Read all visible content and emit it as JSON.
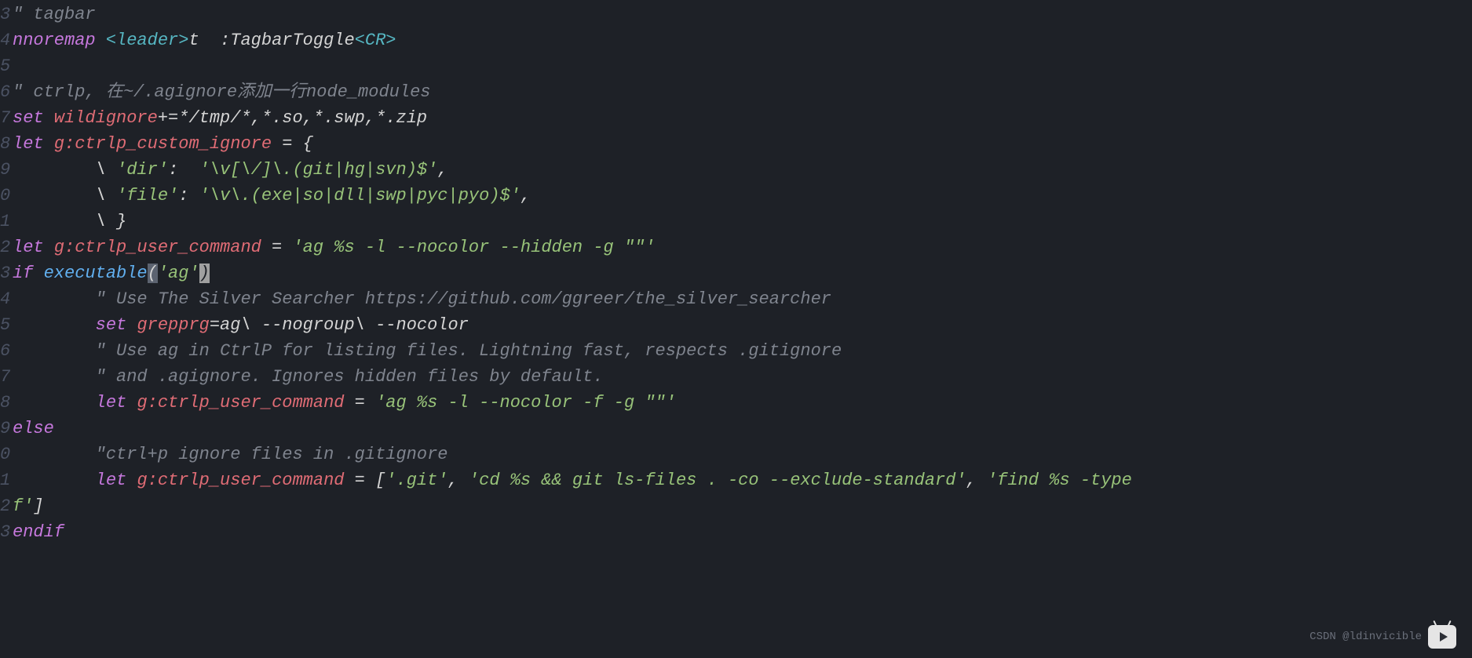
{
  "gutter": {
    "l1": "3",
    "l2": "4",
    "l3": "5",
    "l4": "6",
    "l5": "7",
    "l6": "8",
    "l7": "9",
    "l8": "0",
    "l9": "1",
    "l10": "2",
    "l11": "3",
    "l12": "4",
    "l13": "5",
    "l14": "6",
    "l15": "7",
    "l16": "8",
    "l17": "9",
    "l18": "0",
    "l19": "1",
    "l20": "2",
    "l21": "3"
  },
  "code": {
    "c1": "\" tagbar",
    "l2_kw": "nnoremap",
    "l2_sp": " ",
    "l2_leader": "<leader>",
    "l2_key": "t  :TagbarToggle",
    "l2_cr": "<CR>",
    "c4": "\" ctrlp, 在~/.agignore添加一行node_modules",
    "l5_set": "set",
    "l5_sp": " ",
    "l5_opt": "wildignore",
    "l5_rest": "+=*/tmp/*,*.so,*.swp,*.zip",
    "l6_let": "let",
    "l6_sp": " ",
    "l6_var": "g:ctrlp_custom_ignore",
    "l6_rest": " = {",
    "l7_indent": "        \\ ",
    "l7_key": "'dir'",
    "l7_colon": ":  ",
    "l7_val": "'\\v[\\/]\\.(git|hg|svn)$'",
    "l7_comma": ",",
    "l8_indent": "        \\ ",
    "l8_key": "'file'",
    "l8_colon": ": ",
    "l8_val": "'\\v\\.(exe|so|dll|swp|pyc|pyo)$'",
    "l8_comma": ",",
    "l9_indent": "        \\ }",
    "l10_let": "let",
    "l10_sp": " ",
    "l10_var": "g:ctrlp_user_command",
    "l10_eq": " = ",
    "l10_str": "'ag %s -l --nocolor --hidden -g \"\"'",
    "l11_if": "if",
    "l11_sp": " ",
    "l11_fn": "executable",
    "l11_paren1": "(",
    "l11_str": "'ag'",
    "l11_paren2": ")",
    "c12": "        \" Use The Silver Searcher https://github.com/ggreer/the_silver_searcher",
    "l13_indent": "        ",
    "l13_set": "set",
    "l13_sp": " ",
    "l13_opt": "grepprg",
    "l13_rest": "=ag\\ --nogroup\\ --nocolor",
    "c14": "        \" Use ag in CtrlP for listing files. Lightning fast, respects .gitignore",
    "c15": "        \" and .agignore. Ignores hidden files by default.",
    "l16_indent": "        ",
    "l16_let": "let",
    "l16_sp": " ",
    "l16_var": "g:ctrlp_user_command",
    "l16_eq": " = ",
    "l16_str": "'ag %s -l --nocolor -f -g \"\"'",
    "l17_else": "else",
    "c18": "        \"ctrl+p ignore files in .gitignore",
    "l19_indent": "        ",
    "l19_let": "let",
    "l19_sp": " ",
    "l19_var": "g:ctrlp_user_command",
    "l19_eq": " = [",
    "l19_s1": "'.git'",
    "l19_c1": ", ",
    "l19_s2": "'cd %s && git ls-files . -co --exclude-standard'",
    "l19_c2": ", ",
    "l19_s3": "'find %s -type ",
    "l20_s3b": "f'",
    "l20_close": "]",
    "l21_endif": "endif"
  },
  "watermark": {
    "text": "CSDN @ldinvicible"
  }
}
